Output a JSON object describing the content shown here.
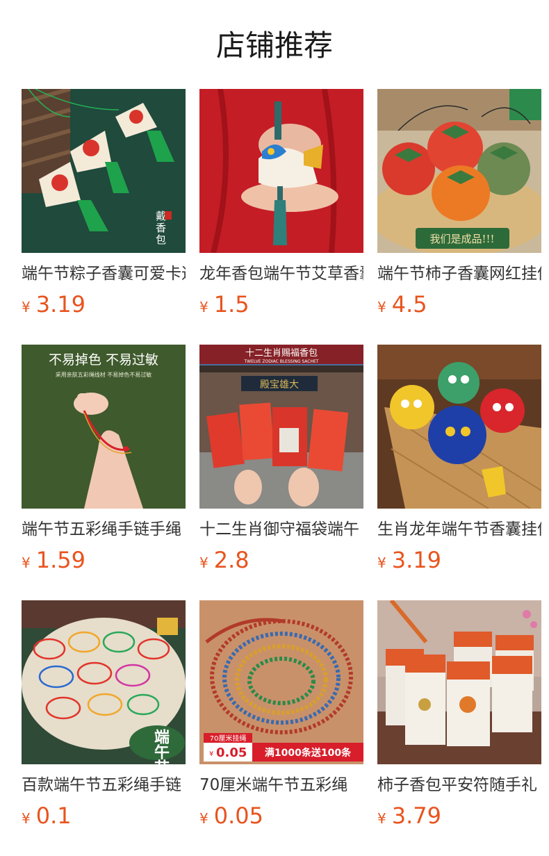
{
  "section": {
    "title": "店铺推荐"
  },
  "products": [
    {
      "title": "端午节粽子香囊可爱卡通",
      "currency": "¥",
      "price": "3.19",
      "image": "zongzi-sachets",
      "overlay": {
        "seal": "戴香包"
      }
    },
    {
      "title": "龙年香包端午节艾草香囊",
      "currency": "¥",
      "price": "1.5",
      "image": "dragon-sachet"
    },
    {
      "title": "端午节柿子香囊网红挂件",
      "currency": "¥",
      "price": "4.5",
      "image": "persimmon-sachets",
      "overlay": {
        "banner": "我们是成品!!!"
      }
    },
    {
      "title": "端午节五彩绳手链手绳",
      "currency": "¥",
      "price": "1.59",
      "image": "bracelet-hand",
      "overlay": {
        "heading": "不易掉色 不易过敏",
        "sub": "采用亲肤五彩绳线材 不易掉色不易过敏"
      }
    },
    {
      "title": "十二生肖御守福袋端午",
      "currency": "¥",
      "price": "2.8",
      "image": "zodiac-pouches",
      "overlay": {
        "heading": "十二生肖赐福香包",
        "sub": "TWELVE ZODIAC BLESSING SACHET",
        "plaque": "殿宝雄大"
      }
    },
    {
      "title": "生肖龙年端午节香囊挂件",
      "currency": "¥",
      "price": "3.19",
      "image": "dragon-toys"
    },
    {
      "title": "百款端午节五彩绳手链",
      "currency": "¥",
      "price": "0.1",
      "image": "bracelets-many",
      "overlay": {
        "stamp": "端午节"
      }
    },
    {
      "title": "70厘米端午节五彩绳",
      "currency": "¥",
      "price": "0.05",
      "image": "rope-coil",
      "overlay": {
        "tag": "70厘米挂绳",
        "tag_currency": "¥",
        "tag_price": "0.05",
        "promo": "满1000条送100条"
      }
    },
    {
      "title": "柿子香包平安符随手礼",
      "currency": "¥",
      "price": "3.79",
      "image": "card-packs"
    }
  ]
}
